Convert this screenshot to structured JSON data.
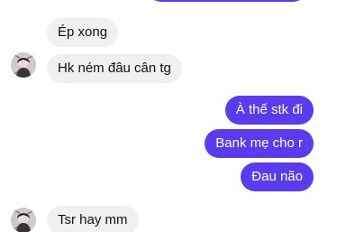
{
  "messages": [
    {
      "side": "incoming",
      "text": "Ép xong"
    },
    {
      "side": "incoming",
      "text": "Hk ném đâu cân tg"
    },
    {
      "side": "outgoing",
      "text": "À thế stk đi"
    },
    {
      "side": "outgoing",
      "text": "Bank mẹ cho r"
    },
    {
      "side": "outgoing",
      "text": "Đau não"
    },
    {
      "side": "incoming",
      "text": "Tsr hay mm"
    }
  ],
  "colors": {
    "incoming_bubble": "#f0f0f1",
    "outgoing_bubble": "#5b3bf0",
    "background": "#ffffff"
  },
  "icons": {
    "contact_avatar": "contact-avatar-icon"
  }
}
